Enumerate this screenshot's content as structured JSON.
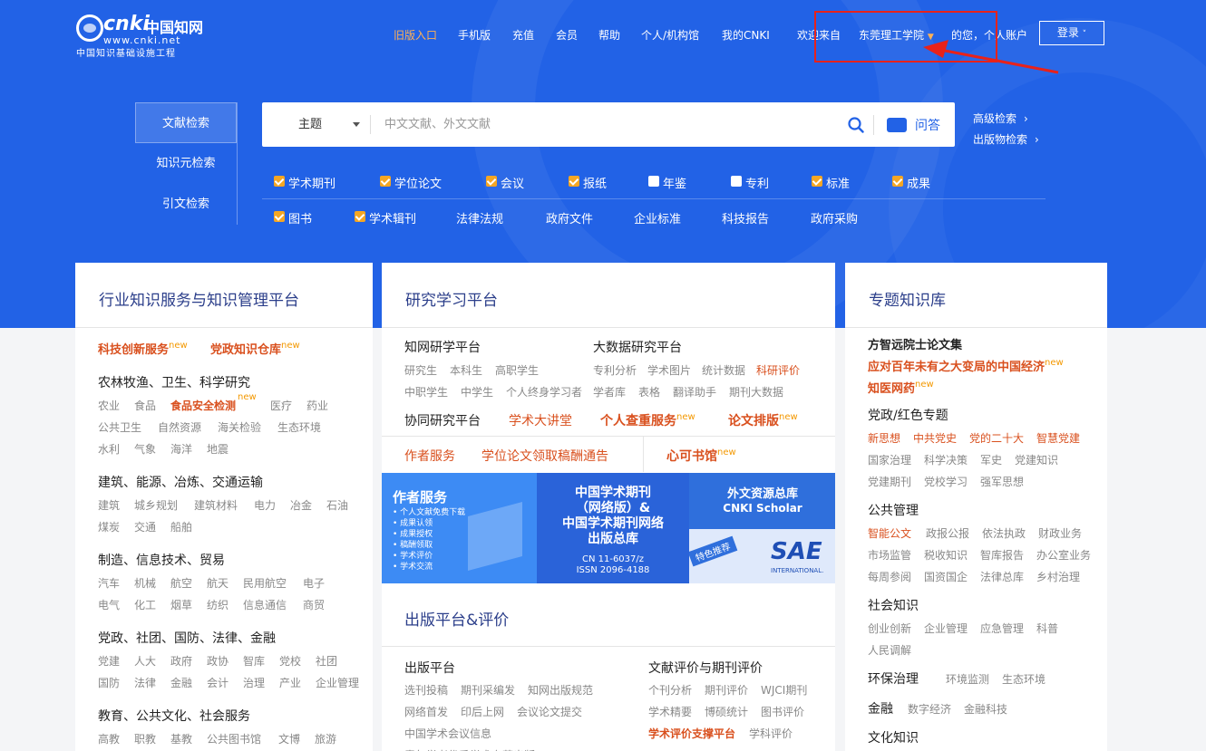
{
  "logo": {
    "brand": "cnki",
    "brand_cn": "中国知网",
    "url": "www.cnki.net",
    "tagline": "中国知识基础设施工程"
  },
  "topnav": {
    "items": [
      "旧版入口",
      "手机版",
      "充值",
      "会员",
      "帮助",
      "个人/机构馆",
      "我的CNKI"
    ],
    "welcome": "欢迎来自",
    "institution": "东莞理工学院",
    "suffix": "的您，个人账户",
    "login": "登录"
  },
  "colors": {
    "hero": "#2262e6",
    "accent": "#ffb155",
    "red": "#d9501e",
    "title": "#2b3e8a",
    "annotation": "#e8221a"
  },
  "search": {
    "tabs": [
      "文献检索",
      "知识元检索",
      "引文检索"
    ],
    "field": "主题",
    "placeholder": "中文文献、外文文献",
    "qa": "问答",
    "advanced": "高级检索",
    "publication": "出版物检索",
    "checks_row1": [
      {
        "label": "学术期刊",
        "checked": true
      },
      {
        "label": "学位论文",
        "checked": true
      },
      {
        "label": "会议",
        "checked": true
      },
      {
        "label": "报纸",
        "checked": true
      },
      {
        "label": "年鉴",
        "checked": false
      },
      {
        "label": "专利",
        "checked": false
      },
      {
        "label": "标准",
        "checked": true
      },
      {
        "label": "成果",
        "checked": true
      }
    ],
    "checks_row2": [
      {
        "label": "图书",
        "checked": true
      },
      {
        "label": "学术辑刊",
        "checked": true
      }
    ],
    "links_row2": [
      "法律法规",
      "政府文件",
      "企业标准",
      "科技报告",
      "政府采购"
    ]
  },
  "card1": {
    "title": "行业知识服务与知识管理平台",
    "hot": [
      {
        "label": "科技创新服务",
        "new": "new"
      },
      {
        "label": "党政知识仓库",
        "new": "new"
      }
    ],
    "sections": [
      {
        "heading": "农林牧渔、卫生、科学研究",
        "rows": [
          [
            "农业",
            "食品",
            "食品安全检测",
            "医疗",
            "药业"
          ],
          [
            "公共卫生",
            "自然资源",
            "海关检验",
            "生态环境"
          ],
          [
            "水利",
            "气象",
            "海洋",
            "地震"
          ]
        ],
        "highlight": "食品安全检测",
        "new": "new"
      },
      {
        "heading": "建筑、能源、冶炼、交通运输",
        "rows": [
          [
            "建筑",
            "城乡规划",
            "建筑材料",
            "电力",
            "冶金",
            "石油"
          ],
          [
            "煤炭",
            "交通",
            "船舶"
          ]
        ]
      },
      {
        "heading": "制造、信息技术、贸易",
        "rows": [
          [
            "汽车",
            "机械",
            "航空",
            "航天",
            "民用航空",
            "电子"
          ],
          [
            "电气",
            "化工",
            "烟草",
            "纺织",
            "信息通信",
            "商贸"
          ]
        ]
      },
      {
        "heading": "党政、社团、国防、法律、金融",
        "rows": [
          [
            "党建",
            "人大",
            "政府",
            "政协",
            "智库",
            "党校",
            "社团"
          ],
          [
            "国防",
            "法律",
            "金融",
            "会计",
            "治理",
            "产业",
            "企业管理"
          ]
        ]
      },
      {
        "heading": "教育、公共文化、社会服务",
        "rows": [
          [
            "高教",
            "职教",
            "基教",
            "公共图书馆",
            "文博",
            "旅游"
          ]
        ]
      }
    ]
  },
  "card2": {
    "title": "研究学习平台",
    "research": {
      "heading": "知网研学平台",
      "row1": [
        "研究生",
        "本科生",
        "高职学生"
      ],
      "row2": [
        "中职学生",
        "中学生",
        "个人终身学习者"
      ]
    },
    "bigdata": {
      "heading": "大数据研究平台",
      "row1": [
        "专利分析",
        "学术图片",
        "统计数据",
        "科研评价"
      ],
      "row2": [
        "学者库",
        "表格",
        "翻译助手",
        "期刊大数据"
      ]
    },
    "collab": {
      "heading": "协同研究平台",
      "items": [
        "学术大讲堂",
        "个人查重服务",
        "论文排版"
      ],
      "new": "new"
    },
    "author_row": {
      "items": [
        "作者服务",
        "学位论文领取稿酬通告"
      ],
      "right": "心可书馆",
      "new": "new"
    },
    "banner1": {
      "title": "作者服务",
      "lines": [
        "• 个人文献免费下载",
        "• 成果认领",
        "• 成果授权",
        "• 稿酬领取",
        "• 学术评价",
        "• 学术交流"
      ]
    },
    "banner2": {
      "lines": [
        "中国学术期刊",
        "（网络版）&",
        "中国学术期刊网络",
        "出版总库"
      ],
      "cn": "CN 11-6037/z",
      "issn": "ISSN 2096-4188"
    },
    "banner3": {
      "title": "外文资源总库",
      "sub": "CNKI Scholar",
      "tag": "特色推荐",
      "logo": "SAE",
      "logo_sub": "INTERNATIONAL."
    },
    "pub_title": "出版平台&评价",
    "pub": {
      "heading": "出版平台",
      "row1": [
        "选刊投稿",
        "期刊采编发",
        "知网出版规范"
      ],
      "row2": [
        "网络首发",
        "印后上网",
        "会议论文提交"
      ],
      "row3": [
        "中国学术会议信息"
      ],
      "row4": [
        "青年学者优秀学术专著出版"
      ]
    },
    "eval": {
      "heading": "文献评价与期刊评价",
      "row1": [
        "个刊分析",
        "期刊评价",
        "WJCI期刊"
      ],
      "row2": [
        "学术精要",
        "博硕统计",
        "图书评价"
      ],
      "row3_red": "学术评价支撑平台",
      "row3": "学科评价"
    }
  },
  "card3": {
    "title": "专题知识库",
    "top": "方智远院士论文集",
    "red1": "应对百年未有之大变局的中国经济",
    "red2": "知医网药",
    "new": "new",
    "sections": [
      {
        "heading": "党政/红色专题",
        "red_row": [
          "新思想",
          "中共党史",
          "党的二十大",
          "智慧党建"
        ],
        "rows": [
          [
            "国家治理",
            "科学决策",
            "军史",
            "党建知识"
          ],
          [
            "党建期刊",
            "党校学习",
            "强军思想"
          ]
        ]
      },
      {
        "heading": "公共管理",
        "red_first": "智能公文",
        "rows": [
          [
            "政报公报",
            "依法执政",
            "财政业务"
          ],
          [
            "市场监管",
            "税收知识",
            "智库报告",
            "办公室业务"
          ],
          [
            "每周参阅",
            "国资国企",
            "法律总库",
            "乡村治理"
          ]
        ]
      },
      {
        "heading": "社会知识",
        "rows": [
          [
            "创业创新",
            "企业管理",
            "应急管理",
            "科普"
          ],
          [
            "人民调解"
          ]
        ]
      },
      {
        "heading": "环保治理",
        "inline": [
          "环境监测",
          "生态环境"
        ]
      },
      {
        "heading": "金融",
        "inline": [
          "数字经济",
          "金融科技"
        ]
      },
      {
        "heading": "文化知识"
      }
    ]
  }
}
